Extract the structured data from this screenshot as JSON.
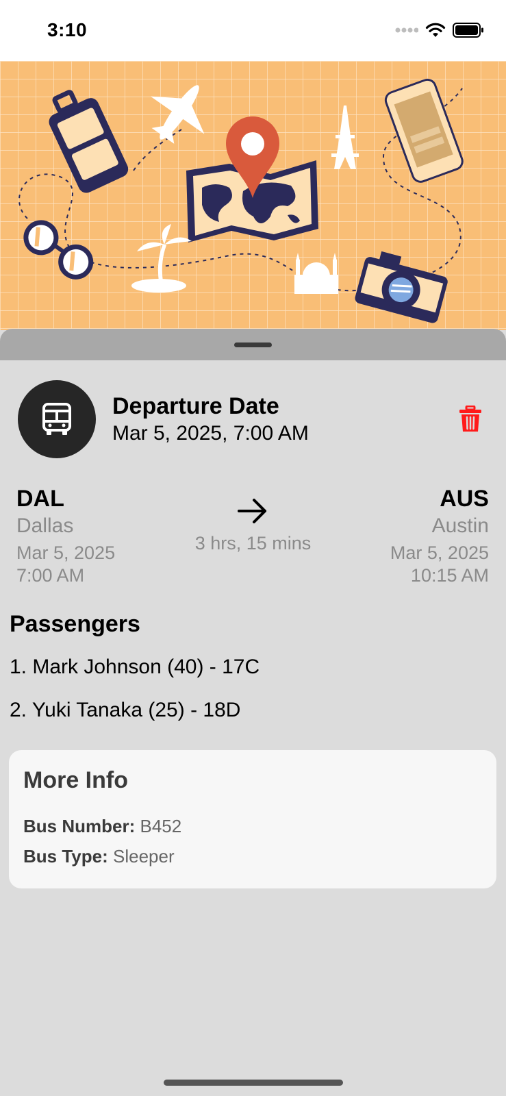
{
  "status": {
    "time": "3:10"
  },
  "departure": {
    "title": "Departure Date",
    "value": "Mar 5, 2025, 7:00 AM"
  },
  "route": {
    "origin": {
      "code": "DAL",
      "city": "Dallas",
      "date": "Mar 5, 2025",
      "time": "7:00 AM"
    },
    "destination": {
      "code": "AUS",
      "city": "Austin",
      "date": "Mar 5, 2025",
      "time": "10:15 AM"
    },
    "duration": "3 hrs, 15 mins"
  },
  "passengers": {
    "title": "Passengers",
    "items": [
      "1. Mark Johnson (40) - 17C",
      "2. Yuki Tanaka (25) - 18D"
    ]
  },
  "more_info": {
    "title": "More Info",
    "bus_number_label": "Bus Number:",
    "bus_number": "B452",
    "bus_type_label": "Bus Type:",
    "bus_type": "Sleeper"
  },
  "colors": {
    "accent_delete": "#ff1a1a",
    "hero_bg": "#f9be76",
    "pin": "#d95a3c",
    "navy": "#2b2a5a"
  },
  "icons": [
    "wifi-icon",
    "battery-icon",
    "bus-icon",
    "trash-icon",
    "arrow-right-icon"
  ]
}
